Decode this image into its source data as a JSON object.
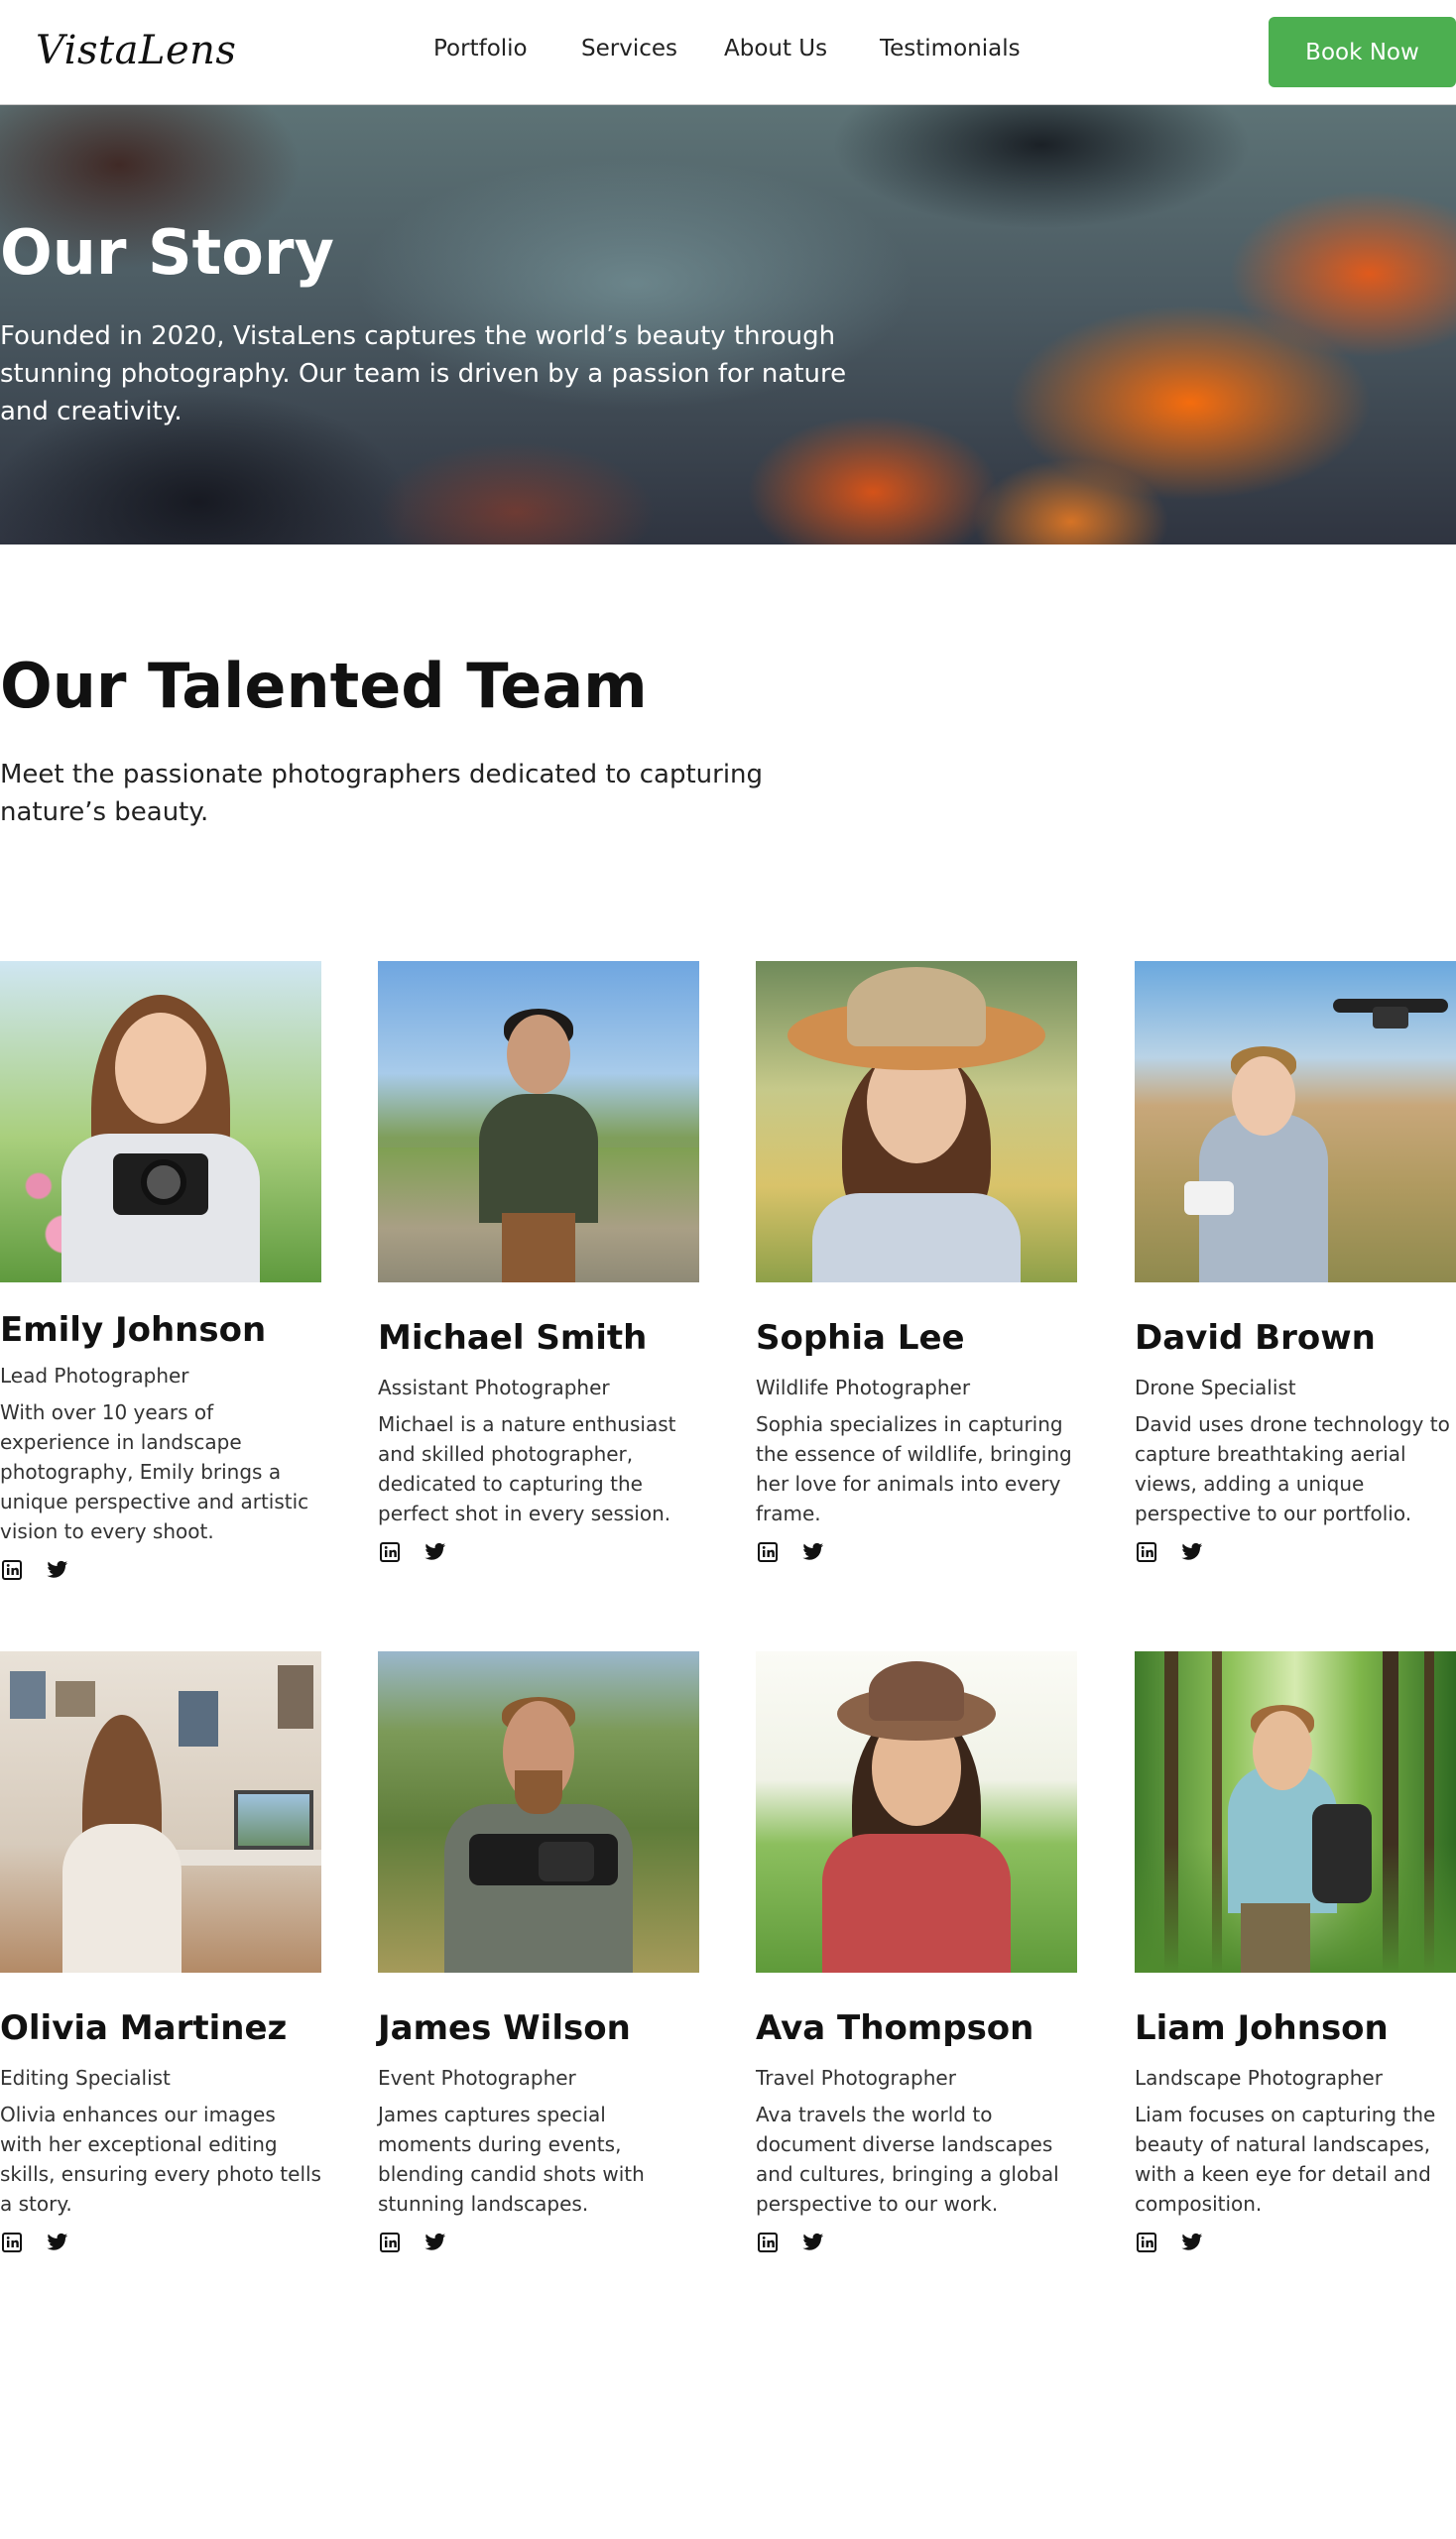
{
  "header": {
    "logo": "VistaLens",
    "nav": [
      "Portfolio",
      "Services",
      "About Us",
      "Testimonials"
    ],
    "cta": "Book Now"
  },
  "hero": {
    "title": "Our Story",
    "text": "Founded in 2020, VistaLens captures the world’s beauty through stunning photography. Our team is driven by a passion for nature and creativity."
  },
  "team": {
    "title": "Our Talented Team",
    "subtitle": "Meet the passionate photographers dedicated to capturing nature’s beauty.",
    "members": [
      {
        "name": "Emily Johnson",
        "role": "Lead Photographer",
        "bio": "With over 10 years of experience in landscape photography, Emily brings a unique perspective and artistic vision to every shoot."
      },
      {
        "name": "Michael Smith",
        "role": "Assistant Photographer",
        "bio": "Michael is a nature enthusiast and skilled photographer, dedicated to capturing the perfect shot in every session."
      },
      {
        "name": "Sophia Lee",
        "role": "Wildlife Photographer",
        "bio": "Sophia specializes in capturing the essence of wildlife, bringing her love for animals into every frame."
      },
      {
        "name": "David Brown",
        "role": "Drone Specialist",
        "bio": "David uses drone technology to capture breathtaking aerial views, adding a unique perspective to our portfolio."
      },
      {
        "name": "Olivia Martinez",
        "role": "Editing Specialist",
        "bio": "Olivia enhances our images with her exceptional editing skills, ensuring every photo tells a story."
      },
      {
        "name": "James Wilson",
        "role": "Event Photographer",
        "bio": "James captures special moments during events, blending candid shots with stunning landscapes."
      },
      {
        "name": "Ava Thompson",
        "role": "Travel Photographer",
        "bio": "Ava travels the world to document diverse landscapes and cultures, bringing a global perspective to our work."
      },
      {
        "name": "Liam Johnson",
        "role": "Landscape Photographer",
        "bio": "Liam focuses on capturing the beauty of natural landscapes, with a keen eye for detail and composition."
      }
    ]
  },
  "colors": {
    "accent": "#4caf50",
    "text": "#111111",
    "muted": "#333333"
  },
  "icons": {
    "social": [
      "linkedin-icon",
      "twitter-icon"
    ]
  }
}
